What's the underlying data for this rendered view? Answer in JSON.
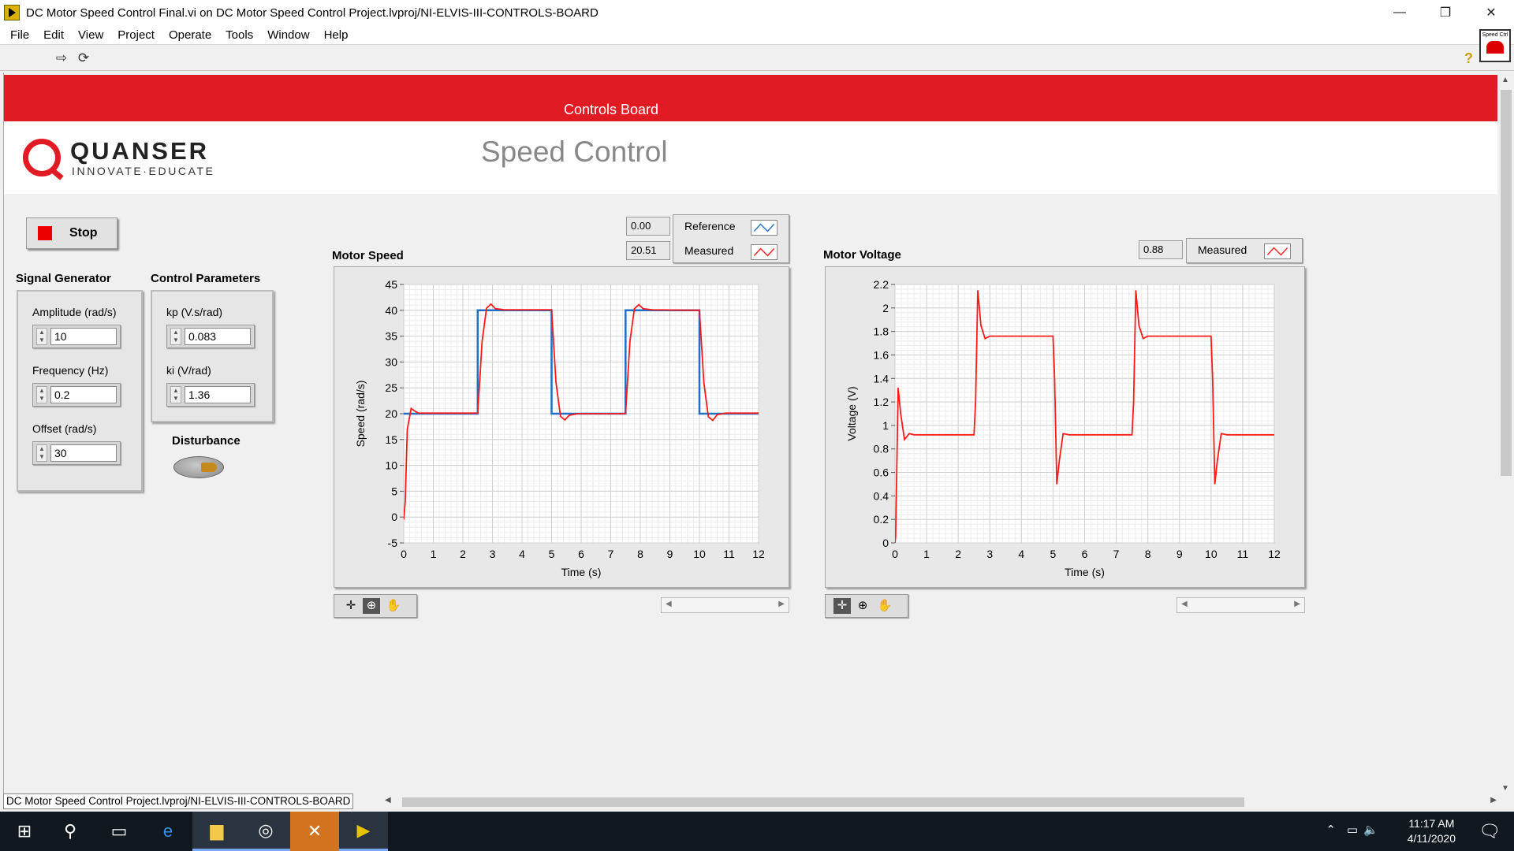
{
  "window": {
    "title": "DC Motor Speed Control Final.vi on DC Motor Speed Control Project.lvproj/NI-ELVIS-III-CONTROLS-BOARD",
    "controls": [
      "—",
      "❐",
      "✕"
    ]
  },
  "menu": [
    "File",
    "Edit",
    "View",
    "Project",
    "Operate",
    "Tools",
    "Window",
    "Help"
  ],
  "vi_icon_text": "Speed Ctrl",
  "banner": {
    "text": "Controls Board"
  },
  "header": {
    "logo_name": "QUANSER",
    "logo_tagline": "INNOVATE·EDUCATE",
    "title": "Speed Control"
  },
  "stop_button": {
    "label": "Stop"
  },
  "signal_generator": {
    "title": "Signal Generator",
    "fields": [
      {
        "label": "Amplitude (rad/s)",
        "value": "10"
      },
      {
        "label": "Frequency (Hz)",
        "value": "0.2"
      },
      {
        "label": "Offset (rad/s)",
        "value": "30"
      }
    ]
  },
  "control_parameters": {
    "title": "Control Parameters",
    "fields": [
      {
        "label": "kp (V.s/rad)",
        "value": "0.083"
      },
      {
        "label": "ki (V/rad)",
        "value": "1.36"
      }
    ]
  },
  "disturbance": {
    "label": "Disturbance"
  },
  "speed_chart": {
    "title": "Motor Speed",
    "legend": [
      {
        "name": "Reference",
        "value": "0.00",
        "color": "#1f6fc4"
      },
      {
        "name": "Measured",
        "value": "20.51",
        "color": "#ff1a1a"
      }
    ]
  },
  "voltage_chart": {
    "title": "Motor Voltage",
    "legend": [
      {
        "name": "Measured",
        "value": "0.88",
        "color": "#ff1a1a"
      }
    ]
  },
  "status_path": "DC Motor Speed Control Project.lvproj/NI-ELVIS-III-CONTROLS-BOARD",
  "clock": {
    "time": "11:17 AM",
    "date": "4/11/2020"
  },
  "chart_data": [
    {
      "type": "line",
      "title": "Motor Speed",
      "xlabel": "Time (s)",
      "ylabel": "Speed (rad/s)",
      "xlim": [
        0,
        12
      ],
      "ylim": [
        -5,
        45
      ],
      "xticks": [
        0,
        1,
        2,
        3,
        4,
        5,
        6,
        7,
        8,
        9,
        10,
        11,
        12
      ],
      "yticks": [
        -5,
        0,
        5,
        10,
        15,
        20,
        25,
        30,
        35,
        40,
        45
      ],
      "grid": true,
      "series": [
        {
          "name": "Reference",
          "color": "#1f6fc4",
          "x": [
            0,
            2.5,
            2.5,
            5,
            5,
            7.5,
            7.5,
            10,
            10,
            12.2
          ],
          "y": [
            20,
            20,
            40,
            40,
            20,
            20,
            40,
            40,
            20,
            20
          ]
        },
        {
          "name": "Measured",
          "color": "#ff1a1a",
          "x": [
            0,
            0.05,
            0.12,
            0.25,
            0.35,
            0.5,
            2.5,
            2.65,
            2.8,
            2.95,
            3.1,
            3.4,
            5.0,
            5.15,
            5.3,
            5.45,
            5.6,
            5.9,
            7.5,
            7.65,
            7.8,
            7.95,
            8.1,
            8.4,
            10.0,
            10.15,
            10.3,
            10.45,
            10.6,
            10.9,
            12.2
          ],
          "y": [
            -0.5,
            3,
            17,
            21,
            20.6,
            20.1,
            20.1,
            34,
            40.4,
            41.2,
            40.3,
            40.1,
            40.1,
            26,
            19.5,
            18.8,
            19.7,
            20,
            20,
            34,
            40.3,
            41.1,
            40.3,
            40.1,
            40,
            26,
            19.4,
            18.7,
            19.8,
            20.1,
            20.1
          ]
        }
      ]
    },
    {
      "type": "line",
      "title": "Motor Voltage",
      "xlabel": "Time (s)",
      "ylabel": "Voltage (V)",
      "xlim": [
        0,
        12
      ],
      "ylim": [
        0,
        2.2
      ],
      "xticks": [
        0,
        1,
        2,
        3,
        4,
        5,
        6,
        7,
        8,
        9,
        10,
        11,
        12
      ],
      "yticks": [
        0,
        0.2,
        0.4,
        0.6,
        0.8,
        1,
        1.2,
        1.4,
        1.6,
        1.8,
        2,
        2.2
      ],
      "grid": true,
      "series": [
        {
          "name": "Measured",
          "color": "#ff1a1a",
          "x": [
            0,
            0.02,
            0.1,
            0.18,
            0.3,
            0.45,
            0.6,
            2.5,
            2.55,
            2.62,
            2.72,
            2.85,
            3.0,
            5.0,
            5.05,
            5.12,
            5.2,
            5.32,
            5.5,
            7.5,
            7.55,
            7.62,
            7.72,
            7.85,
            8.0,
            10.0,
            10.05,
            10.12,
            10.2,
            10.32,
            10.5,
            12.0
          ],
          "y": [
            0,
            0.05,
            1.32,
            1.1,
            0.88,
            0.93,
            0.92,
            0.92,
            1.2,
            2.15,
            1.85,
            1.74,
            1.76,
            1.76,
            1.4,
            0.5,
            0.7,
            0.93,
            0.92,
            0.92,
            1.2,
            2.15,
            1.85,
            1.74,
            1.76,
            1.76,
            1.4,
            0.5,
            0.7,
            0.93,
            0.92,
            0.92
          ]
        }
      ]
    }
  ]
}
